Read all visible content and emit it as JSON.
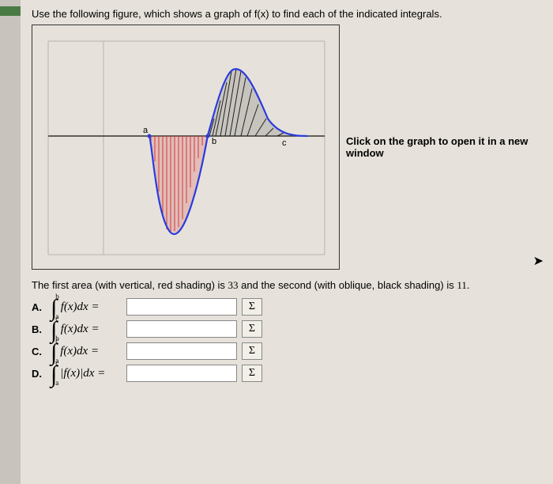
{
  "prompt": "Use the following figure, which shows a graph of f(x) to find each of the indicated integrals.",
  "graph": {
    "caption": "Click on the graph to open it in a new window",
    "labels": {
      "a": "a",
      "b": "b",
      "c": "c"
    }
  },
  "area_text": {
    "p1": "The first area (with vertical, red shading) is ",
    "v1": "33",
    "p2": " and the second (with oblique, black shading) is ",
    "v2": "11",
    "p3": "."
  },
  "questions": {
    "A": {
      "label": "A.",
      "upper": "b",
      "lower": "a",
      "integrand": "f(x)dx ="
    },
    "B": {
      "label": "B.",
      "upper": "c",
      "lower": "b",
      "integrand": "f(x)dx ="
    },
    "C": {
      "label": "C.",
      "upper": "c",
      "lower": "a",
      "integrand": "f(x)dx ="
    },
    "D": {
      "label": "D.",
      "upper": "c",
      "lower": "a",
      "integrand": "|f(x)|dx ="
    }
  },
  "sigma": "Σ",
  "chart_data": {
    "type": "area",
    "title": "",
    "xlabel": "",
    "ylabel": "",
    "x_range": [
      -1.2,
      3.2
    ],
    "y_range": [
      -4.5,
      4.0
    ],
    "curve_points_x": [
      -1,
      -0.5,
      0,
      0.3,
      0.6,
      0.9,
      1,
      1.3,
      1.6,
      2.0,
      2.5,
      3.0
    ],
    "curve_points_y": [
      0,
      -1.5,
      -4.2,
      -4.0,
      -2.0,
      0,
      0.5,
      2.5,
      3.5,
      1.0,
      0.2,
      0
    ],
    "marked_points": {
      "a": {
        "x": -1,
        "y": 0
      },
      "b": {
        "x": 0.9,
        "y": 0
      },
      "c": {
        "x": 3.0,
        "y": 0
      }
    },
    "regions": [
      {
        "name": "red_vertical",
        "from": "a",
        "to": "b",
        "signed_area": -33,
        "abs_area": 33
      },
      {
        "name": "black_oblique",
        "from": "b",
        "to": "c",
        "signed_area": 11,
        "abs_area": 11
      }
    ]
  }
}
